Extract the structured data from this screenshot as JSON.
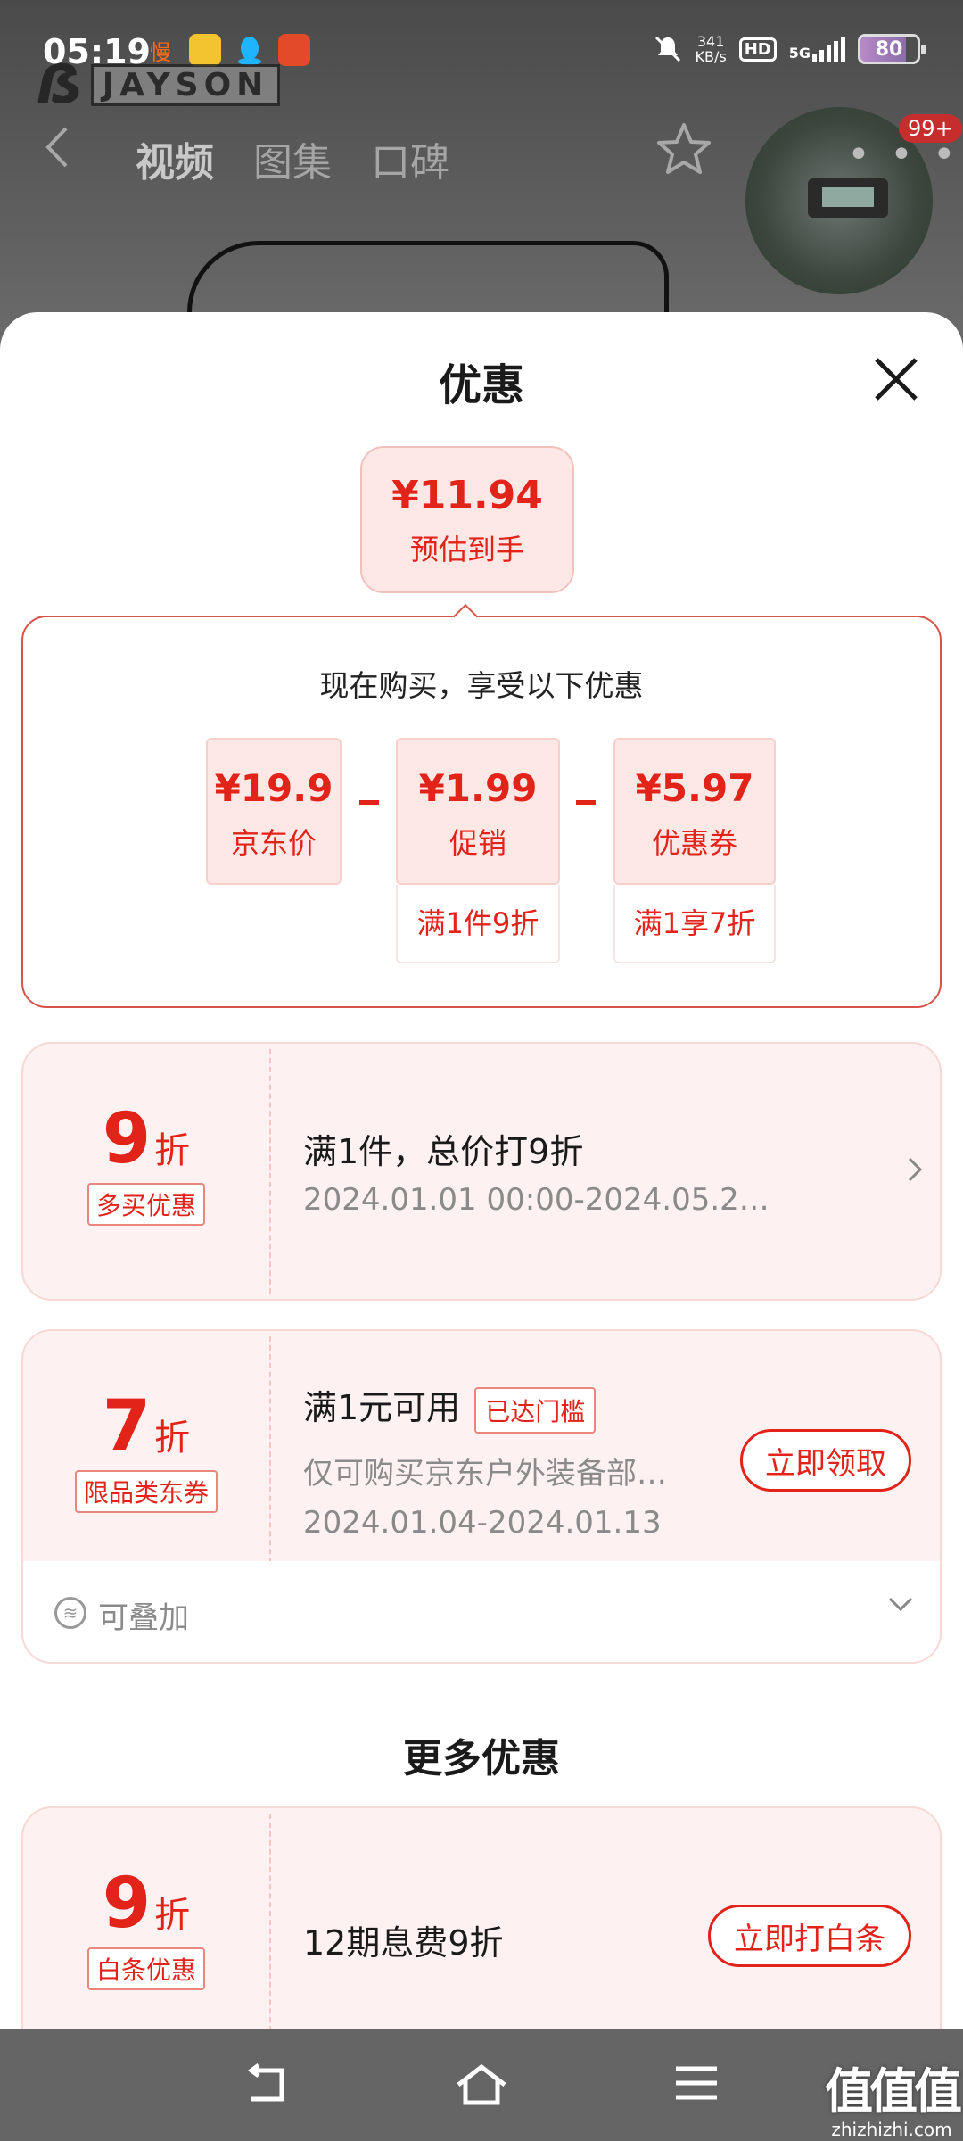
{
  "status_bar": {
    "time": "05:19",
    "net_speed_value": "341",
    "net_speed_unit": "KB/s",
    "hd_label": "HD",
    "network": "5G",
    "battery": "80",
    "app_icons": [
      "慢",
      "",
      "",
      ""
    ]
  },
  "background_page": {
    "watermark_text": "JAYSON",
    "tabs": [
      "视频",
      "图集",
      "口碑"
    ],
    "more_dots": "• • •",
    "badge": "99+"
  },
  "sheet": {
    "title": "优惠",
    "estimate": {
      "price": "¥11.94",
      "label": "预估到手"
    },
    "breakdown": {
      "title": "现在购买，享受以下优惠",
      "items": [
        {
          "amount": "¥19.9",
          "name": "京东价",
          "sub": ""
        },
        {
          "amount": "¥1.99",
          "name": "促销",
          "sub": "满1件9折"
        },
        {
          "amount": "¥5.97",
          "name": "优惠券",
          "sub": "满1享7折"
        }
      ]
    },
    "coupons": [
      {
        "discount": "9",
        "unit": "折",
        "tag": "多买优惠",
        "main": "满1件，总价打9折",
        "period": "2024.01.01 00:00-2024.05.2…"
      },
      {
        "discount": "7",
        "unit": "折",
        "tag": "限品类东券",
        "main": "满1元可用",
        "reach_tag": "已达门槛",
        "scope": "仅可购买京东户外装备部…",
        "period": "2024.01.04-2024.01.13",
        "button": "立即领取",
        "stack_label": "可叠加"
      }
    ],
    "more_title": "更多优惠",
    "more_coupons": [
      {
        "discount": "9",
        "unit": "折",
        "tag": "白条优惠",
        "main": "12期息费9折",
        "button": "立即打白条"
      }
    ]
  },
  "site_watermark": {
    "cn": "值值值",
    "en": "zhizhizhi.com"
  },
  "colors": {
    "accent": "#e2231a",
    "coupon_bg": "#fdf2f1",
    "estimate_bg": "#fde8e6"
  }
}
